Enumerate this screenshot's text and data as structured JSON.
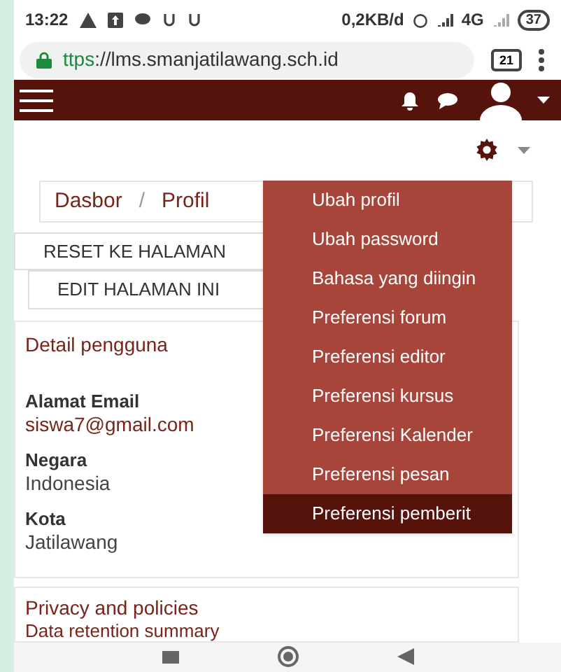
{
  "status_bar": {
    "time": "13:22",
    "network_speed": "0,2KB/d",
    "network_type": "4G",
    "battery": "37"
  },
  "browser": {
    "url_scheme": "ttps",
    "url_rest": "://lms.smanjatilawang.sch.id",
    "tab_count": "21"
  },
  "breadcrumb": [
    "Dasbor",
    "Profil"
  ],
  "breadcrumb_separator": "/",
  "page_buttons": [
    "RESET KE HALAMAN",
    "EDIT HALAMAN INI"
  ],
  "user_details": {
    "title": "Detail pengguna",
    "fields": [
      {
        "label": "Alamat Email",
        "value": "siswa7@gmail.com",
        "kind": "link"
      },
      {
        "label": "Negara",
        "value": "Indonesia",
        "kind": "text"
      },
      {
        "label": "Kota",
        "value": "Jatilawang",
        "kind": "text"
      }
    ]
  },
  "privacy": {
    "title": "Privacy and policies",
    "link": "Data retention summary"
  },
  "settings_menu": [
    {
      "label": "Ubah profil",
      "selected": false
    },
    {
      "label": "Ubah password",
      "selected": false
    },
    {
      "label": "Bahasa yang diingin",
      "selected": false
    },
    {
      "label": "Preferensi forum",
      "selected": false
    },
    {
      "label": "Preferensi editor",
      "selected": false
    },
    {
      "label": "Preferensi kursus",
      "selected": false
    },
    {
      "label": "Preferensi Kalender",
      "selected": false
    },
    {
      "label": "Preferensi pesan",
      "selected": false
    },
    {
      "label": "Preferensi pemberit",
      "selected": true
    }
  ]
}
